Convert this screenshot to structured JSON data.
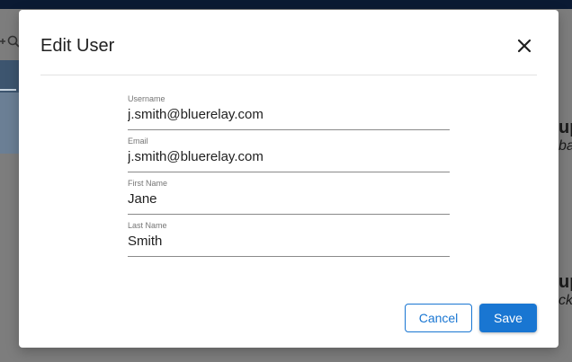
{
  "background": {
    "heading_1": "up",
    "sub_1": "ba",
    "heading_2": "up",
    "sub_2": "ck"
  },
  "dialog": {
    "title": "Edit User",
    "close_icon": "close-icon",
    "fields": [
      {
        "label": "Username",
        "value": "j.smith@bluerelay.com"
      },
      {
        "label": "Email",
        "value": "j.smith@bluerelay.com"
      },
      {
        "label": "First Name",
        "value": "Jane"
      },
      {
        "label": "Last Name",
        "value": "Smith"
      }
    ],
    "cancel_label": "Cancel",
    "save_label": "Save"
  },
  "colors": {
    "accent": "#1976d2",
    "overlay": "#7d7d7d",
    "topbar": "#0b1a33"
  }
}
